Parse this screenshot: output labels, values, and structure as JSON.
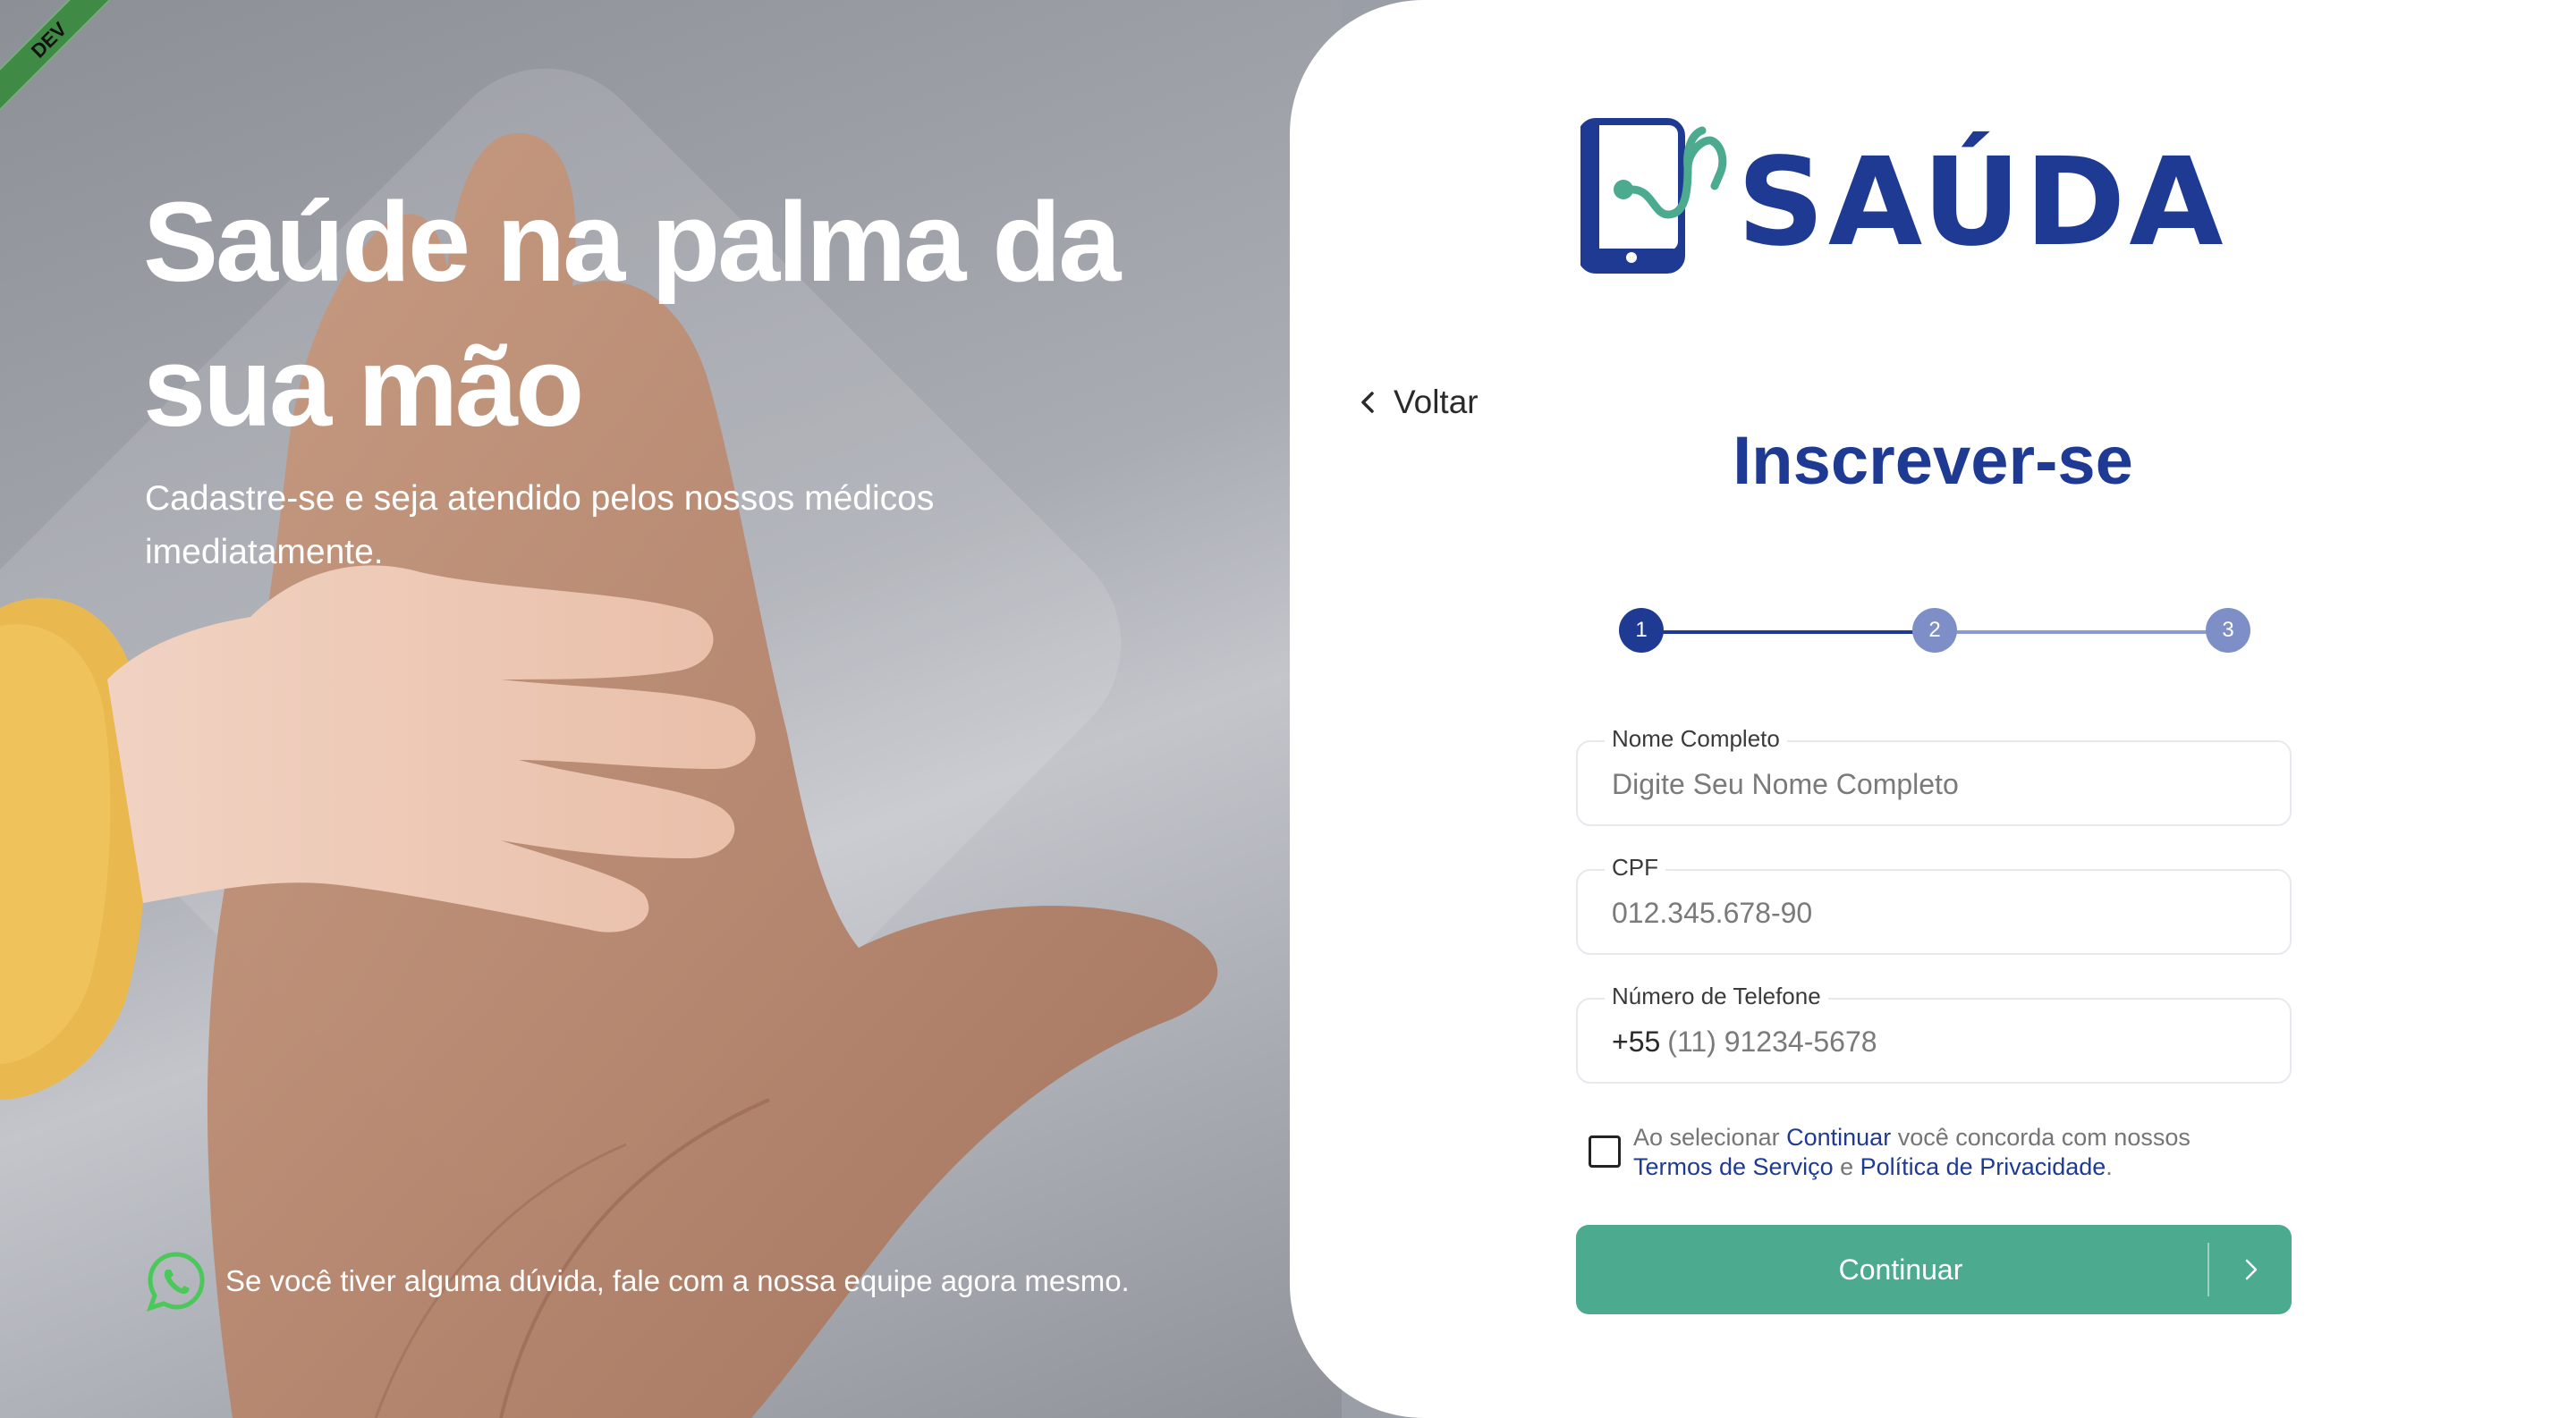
{
  "badge": {
    "env": "DEV"
  },
  "hero": {
    "title": "Saúde na palma da sua mão",
    "subtitle": "Cadastre-se e seja atendido pelos nossos médicos imediatamente.",
    "help_text": "Se você tiver alguma dúvida, fale com a nossa equipe agora mesmo."
  },
  "brand": {
    "name": "SAÚDA",
    "primary_color": "#1f3a93",
    "accent_color": "#4caa8f"
  },
  "nav": {
    "back_label": "Voltar"
  },
  "form": {
    "title": "Inscrever-se",
    "steps": [
      "1",
      "2",
      "3"
    ],
    "current_step": 1,
    "fields": {
      "name": {
        "label": "Nome Completo",
        "placeholder": "Digite Seu Nome Completo"
      },
      "cpf": {
        "label": "CPF",
        "placeholder": "012.345.678-90"
      },
      "phone": {
        "label": "Número de Telefone",
        "prefix": "+55",
        "placeholder": "(11) 91234-5678"
      }
    },
    "terms": {
      "part1": "Ao selecionar ",
      "link_continue": "Continuar",
      "part2": " você concorda com nossos ",
      "link_terms": "Termos de Serviço",
      "part3": " e ",
      "link_privacy": "Política de Privacidade",
      "part4": ".",
      "checked": false
    },
    "submit_label": "Continuar"
  }
}
